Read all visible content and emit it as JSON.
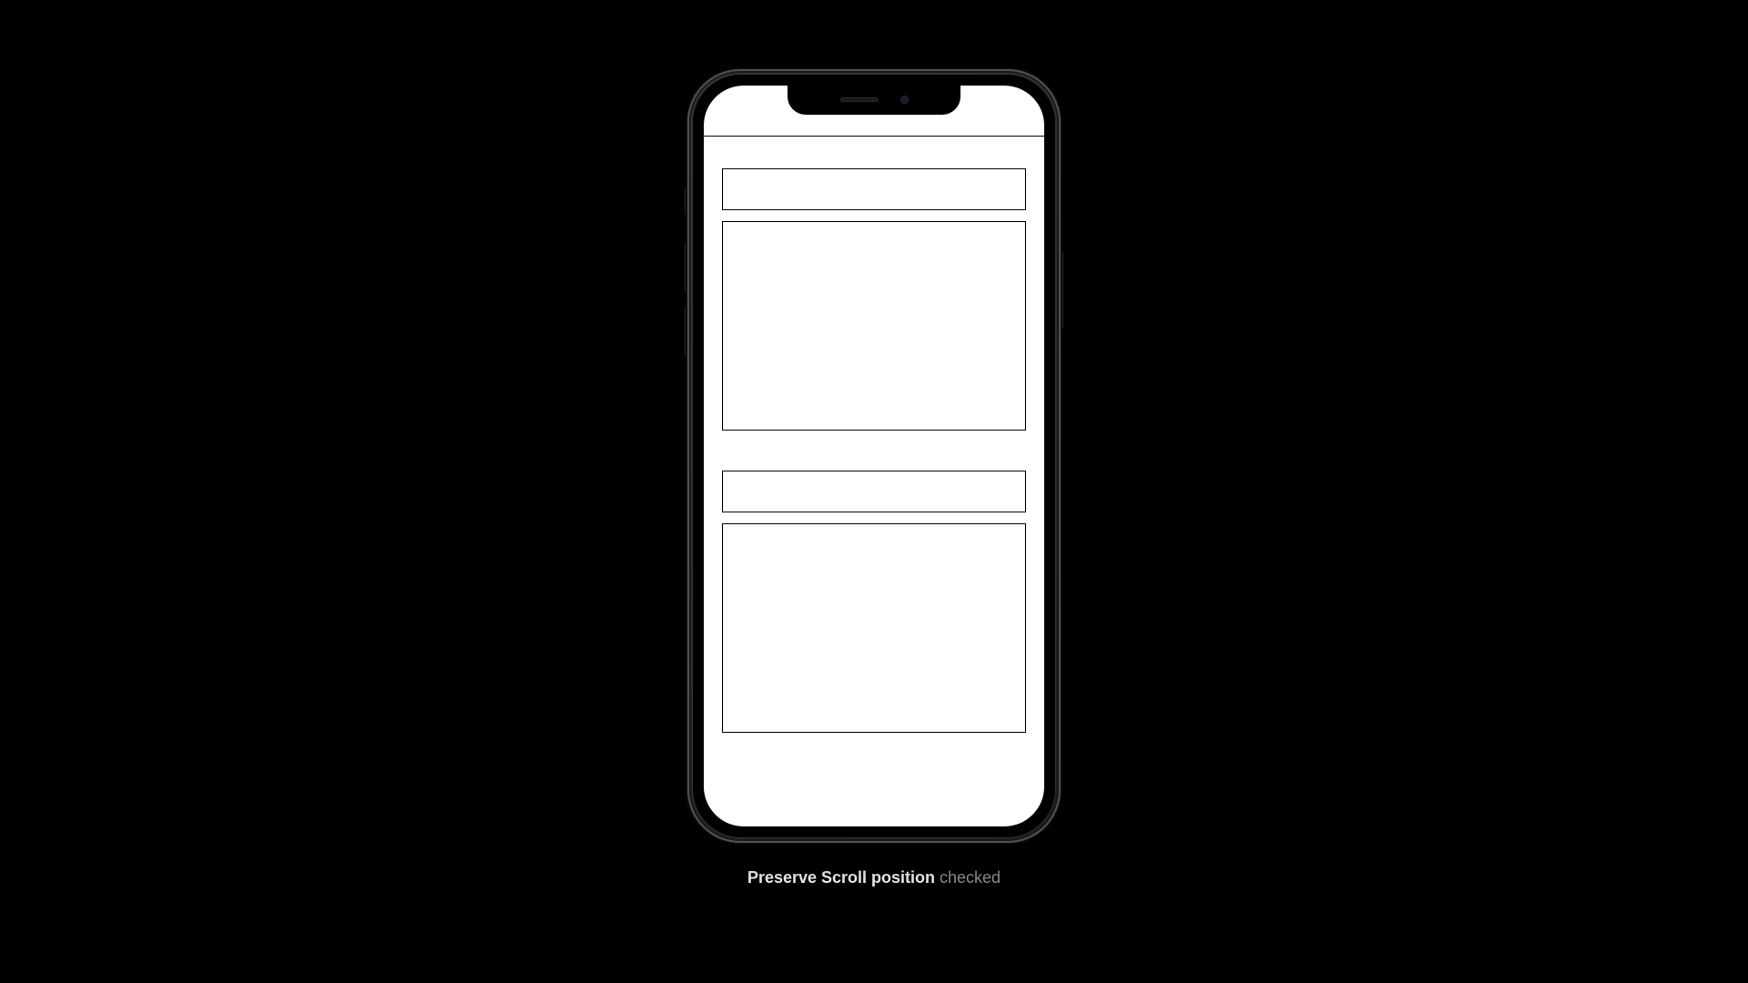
{
  "caption": {
    "label_bold": "Preserve Scroll position",
    "label_rest": " checked"
  }
}
